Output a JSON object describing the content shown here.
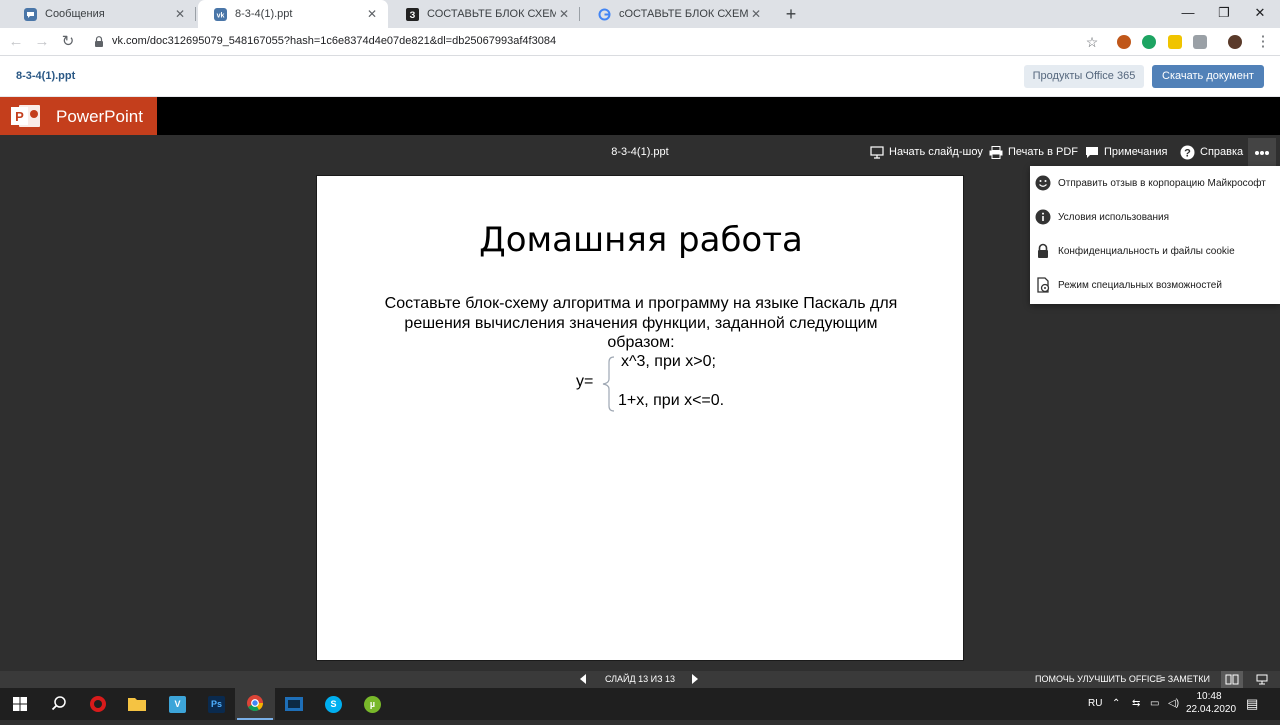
{
  "browser": {
    "tabs": [
      {
        "title": "Сообщения",
        "icon": "vk-messages-icon",
        "color": "#4a76a8"
      },
      {
        "title": "8-3-4(1).ppt",
        "icon": "vk-icon",
        "color": "#4a76a8",
        "active": true
      },
      {
        "title": "СОСТАВЬТЕ БЛОК СХЕМУ И ПР",
        "icon": "znanija-icon",
        "color": "#222222"
      },
      {
        "title": "сОСТАВЬТЕ БЛОК СХЕМУ АЛГОр",
        "icon": "google-icon",
        "color": "#4285f4"
      }
    ],
    "new_tab": "+",
    "close_glyph": "✕",
    "url": "vk.com/doc312695079_548167055?hash=1c6e8374d4e07de821&dl=db25067993af4f3084"
  },
  "vk": {
    "file_name": "8-3-4(1).ppt",
    "office_button": "Продукты Office 365",
    "download_button": "Скачать документ"
  },
  "ppt": {
    "app_name": "PowerPoint",
    "doc_title": "8-3-4(1).ppt",
    "commands": {
      "slideshow": "Начать слайд-шоу",
      "print_pdf": "Печать в PDF",
      "comments": "Примечания",
      "help": "Справка"
    }
  },
  "slide": {
    "title": "Домашняя работа",
    "body": "Составьте блок-схему алгоритма и программу на языке Паскаль для решения вычисления значения функции, заданной следующим образом:",
    "y_label": "y=",
    "case1": "x^3, при x>0;",
    "case2": "1+x, при x<=0."
  },
  "menu": {
    "items": [
      {
        "label": "Отправить отзыв в корпорацию Майкрософт",
        "icon": "smiley-icon"
      },
      {
        "label": "Условия использования",
        "icon": "info-icon"
      },
      {
        "label": "Конфиденциальность и файлы cookie",
        "icon": "lock-icon"
      },
      {
        "label": "Режим специальных возможностей",
        "icon": "accessibility-icon"
      }
    ]
  },
  "status": {
    "slide_counter": "СЛАЙД 13 ИЗ 13",
    "improve_office": "ПОМОЧЬ УЛУЧШИТЬ OFFICE",
    "notes": "ЗАМЕТКИ"
  },
  "taskbar": {
    "language": "RU",
    "time": "10:48",
    "date": "22.04.2020"
  }
}
